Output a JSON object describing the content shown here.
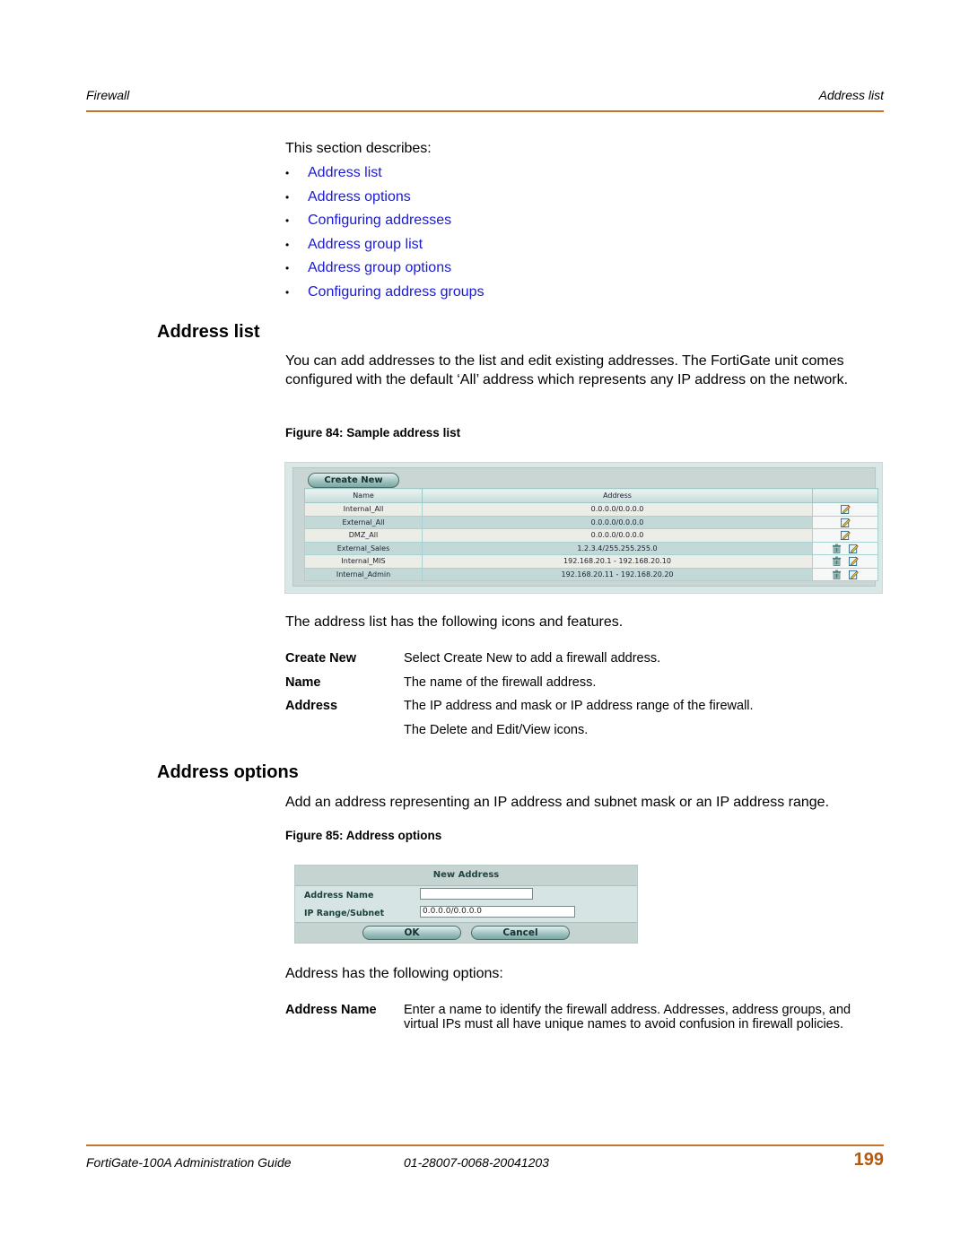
{
  "header": {
    "section": "Firewall",
    "topic": "Address list",
    "rule_color": "#c8742c"
  },
  "intro": {
    "lead": "This section describes:",
    "links": [
      "Address list",
      "Address options",
      "Configuring addresses",
      "Address group list",
      "Address group options",
      "Configuring address groups"
    ],
    "link_color": "#1a1ad6"
  },
  "address_list": {
    "heading": "Address list",
    "paragraph": "You can add addresses to the list and edit existing addresses. The FortiGate unit comes configured with the default ‘All’ address which represents any IP address on the network.",
    "figure_caption": "Figure 84: Sample address list",
    "figure": {
      "create_new_label": "Create New",
      "columns": [
        "Name",
        "Address",
        ""
      ],
      "rows": [
        {
          "name": "Internal_All",
          "address": "0.0.0.0/0.0.0.0",
          "icons": [
            "edit-icon"
          ]
        },
        {
          "name": "External_All",
          "address": "0.0.0.0/0.0.0.0",
          "icons": [
            "edit-icon"
          ]
        },
        {
          "name": "DMZ_All",
          "address": "0.0.0.0/0.0.0.0",
          "icons": [
            "edit-icon"
          ]
        },
        {
          "name": "External_Sales",
          "address": "1.2.3.4/255.255.255.0",
          "icons": [
            "delete-icon",
            "edit-icon"
          ]
        },
        {
          "name": "Internal_MIS",
          "address": "192.168.20.1 - 192.168.20.10",
          "icons": [
            "delete-icon",
            "edit-icon"
          ]
        },
        {
          "name": "Internal_Admin",
          "address": "192.168.20.11 - 192.168.20.20",
          "icons": [
            "delete-icon",
            "edit-icon"
          ]
        }
      ]
    },
    "features_intro": "The address list has the following icons and features.",
    "features": [
      {
        "term": "Create New",
        "desc": "Select Create New to add a firewall address."
      },
      {
        "term": "Name",
        "desc": "The name of the firewall address."
      },
      {
        "term": "Address",
        "desc": "The IP address and mask or IP address range of the firewall."
      },
      {
        "term": "",
        "desc": "The Delete and Edit/View icons."
      }
    ]
  },
  "address_options": {
    "heading": "Address options",
    "paragraph": "Add an address representing an IP address and subnet mask or an IP address range.",
    "figure_caption": "Figure 85: Address options",
    "figure": {
      "title": "New Address",
      "fields": [
        {
          "label": "Address Name",
          "value": ""
        },
        {
          "label": "IP Range/Subnet",
          "value": "0.0.0.0/0.0.0.0"
        }
      ],
      "ok_label": "OK",
      "cancel_label": "Cancel"
    },
    "options_intro": "Address has the following options:",
    "options": [
      {
        "term": "Address Name",
        "desc": "Enter a name to identify the firewall address. Addresses, address groups, and virtual IPs must all have unique names to avoid confusion in firewall policies."
      }
    ]
  },
  "footer": {
    "guide_title": "FortiGate-100A Administration Guide",
    "doc_number": "01-28007-0068-20041203",
    "page_number": "199",
    "page_number_color": "#b35a10"
  }
}
